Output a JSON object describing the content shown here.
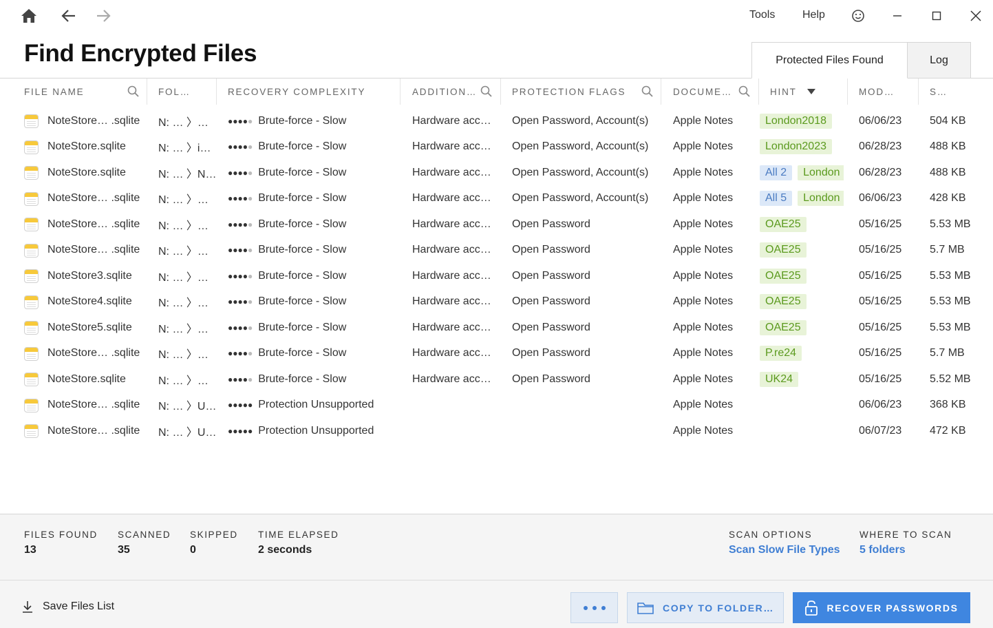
{
  "topbar": {
    "menu_tools": "Tools",
    "menu_help": "Help"
  },
  "page": {
    "title": "Find Encrypted Files"
  },
  "tabs": [
    {
      "label": "Protected Files Found",
      "active": true
    },
    {
      "label": "Log",
      "active": false
    }
  ],
  "columns": {
    "file_name": "FILE NAME",
    "folder": "FOL…",
    "recovery_complexity": "RECOVERY COMPLEXITY",
    "additional": "ADDITION…",
    "protection_flags": "PROTECTION FLAGS",
    "document": "DOCUME…",
    "hint": "HINT",
    "modified": "MOD…",
    "size": "S…"
  },
  "rows": [
    {
      "name": "NoteStore… .sqlite",
      "folder": "N: … 〉…",
      "level": 4,
      "complexity": "Brute-force - Slow",
      "additional": "Hardware acc…",
      "flags": "Open Password, Account(s)",
      "document": "Apple Notes",
      "hints": [
        {
          "text": "London2018",
          "color": "green"
        }
      ],
      "modified": "06/06/23",
      "size": "504 KB"
    },
    {
      "name": "NoteStore.sqlite",
      "folder": "N: … 〉i…",
      "level": 4,
      "complexity": "Brute-force - Slow",
      "additional": "Hardware acc…",
      "flags": "Open Password, Account(s)",
      "document": "Apple Notes",
      "hints": [
        {
          "text": "London2023",
          "color": "green"
        }
      ],
      "modified": "06/28/23",
      "size": "488 KB"
    },
    {
      "name": "NoteStore.sqlite",
      "folder": "N: … 〉N…",
      "level": 4,
      "complexity": "Brute-force - Slow",
      "additional": "Hardware acc…",
      "flags": "Open Password, Account(s)",
      "document": "Apple Notes",
      "hints": [
        {
          "text": "All 2",
          "color": "blue"
        },
        {
          "text": "London",
          "color": "green"
        }
      ],
      "modified": "06/28/23",
      "size": "488 KB"
    },
    {
      "name": "NoteStore… .sqlite",
      "folder": "N: … 〉…",
      "level": 4,
      "complexity": "Brute-force - Slow",
      "additional": "Hardware acc…",
      "flags": "Open Password, Account(s)",
      "document": "Apple Notes",
      "hints": [
        {
          "text": "All 5",
          "color": "blue"
        },
        {
          "text": "London",
          "color": "green"
        }
      ],
      "modified": "06/06/23",
      "size": "428 KB"
    },
    {
      "name": "NoteStore… .sqlite",
      "folder": "N: … 〉…",
      "level": 4,
      "complexity": "Brute-force - Slow",
      "additional": "Hardware acc…",
      "flags": "Open Password",
      "document": "Apple Notes",
      "hints": [
        {
          "text": "OAE25",
          "color": "green"
        }
      ],
      "modified": "05/16/25",
      "size": "5.53 MB"
    },
    {
      "name": "NoteStore… .sqlite",
      "folder": "N: … 〉…",
      "level": 4,
      "complexity": "Brute-force - Slow",
      "additional": "Hardware acc…",
      "flags": "Open Password",
      "document": "Apple Notes",
      "hints": [
        {
          "text": "OAE25",
          "color": "green"
        }
      ],
      "modified": "05/16/25",
      "size": "5.7 MB"
    },
    {
      "name": "NoteStore3.sqlite",
      "folder": "N: … 〉…",
      "level": 4,
      "complexity": "Brute-force - Slow",
      "additional": "Hardware acc…",
      "flags": "Open Password",
      "document": "Apple Notes",
      "hints": [
        {
          "text": "OAE25",
          "color": "green"
        }
      ],
      "modified": "05/16/25",
      "size": "5.53 MB"
    },
    {
      "name": "NoteStore4.sqlite",
      "folder": "N: … 〉…",
      "level": 4,
      "complexity": "Brute-force - Slow",
      "additional": "Hardware acc…",
      "flags": "Open Password",
      "document": "Apple Notes",
      "hints": [
        {
          "text": "OAE25",
          "color": "green"
        }
      ],
      "modified": "05/16/25",
      "size": "5.53 MB"
    },
    {
      "name": "NoteStore5.sqlite",
      "folder": "N: … 〉…",
      "level": 4,
      "complexity": "Brute-force - Slow",
      "additional": "Hardware acc…",
      "flags": "Open Password",
      "document": "Apple Notes",
      "hints": [
        {
          "text": "OAE25",
          "color": "green"
        }
      ],
      "modified": "05/16/25",
      "size": "5.53 MB"
    },
    {
      "name": "NoteStore… .sqlite",
      "folder": "N: … 〉…",
      "level": 4,
      "complexity": "Brute-force - Slow",
      "additional": "Hardware acc…",
      "flags": "Open Password",
      "document": "Apple Notes",
      "hints": [
        {
          "text": "P.re24",
          "color": "green"
        }
      ],
      "modified": "05/16/25",
      "size": "5.7 MB"
    },
    {
      "name": "NoteStore.sqlite",
      "folder": "N: … 〉…",
      "level": 4,
      "complexity": "Brute-force - Slow",
      "additional": "Hardware acc…",
      "flags": "Open Password",
      "document": "Apple Notes",
      "hints": [
        {
          "text": "UK24",
          "color": "green"
        }
      ],
      "modified": "05/16/25",
      "size": "5.52 MB"
    },
    {
      "name": "NoteStore… .sqlite",
      "folder": "N: … 〉U…",
      "level": 5,
      "complexity": "Protection Unsupported",
      "additional": "",
      "flags": "",
      "document": "Apple Notes",
      "hints": [],
      "modified": "06/06/23",
      "size": "368 KB"
    },
    {
      "name": "NoteStore… .sqlite",
      "folder": "N: … 〉U…",
      "level": 5,
      "complexity": "Protection Unsupported",
      "additional": "",
      "flags": "",
      "document": "Apple Notes",
      "hints": [],
      "modified": "06/07/23",
      "size": "472 KB"
    }
  ],
  "stats": {
    "files_found_label": "FILES FOUND",
    "files_found_value": "13",
    "scanned_label": "SCANNED",
    "scanned_value": "35",
    "skipped_label": "SKIPPED",
    "skipped_value": "0",
    "time_label": "TIME ELAPSED",
    "time_value": "2 seconds",
    "scan_options_label": "SCAN OPTIONS",
    "scan_options_value": "Scan Slow File Types",
    "where_label": "WHERE TO SCAN",
    "where_value": "5 folders"
  },
  "actions": {
    "save_label": "Save Files List",
    "copy_label": "COPY TO FOLDER…",
    "recover_label": "RECOVER PASSWORDS"
  },
  "colors": {
    "accent": "#3f86e0",
    "link": "#3f7ed3",
    "hint_green_bg": "#e8f3d8",
    "hint_green_text": "#5b9a1e",
    "hint_blue_bg": "#dce8f8",
    "hint_blue_text": "#4a7bc2",
    "note_icon": "#f7c93b"
  }
}
